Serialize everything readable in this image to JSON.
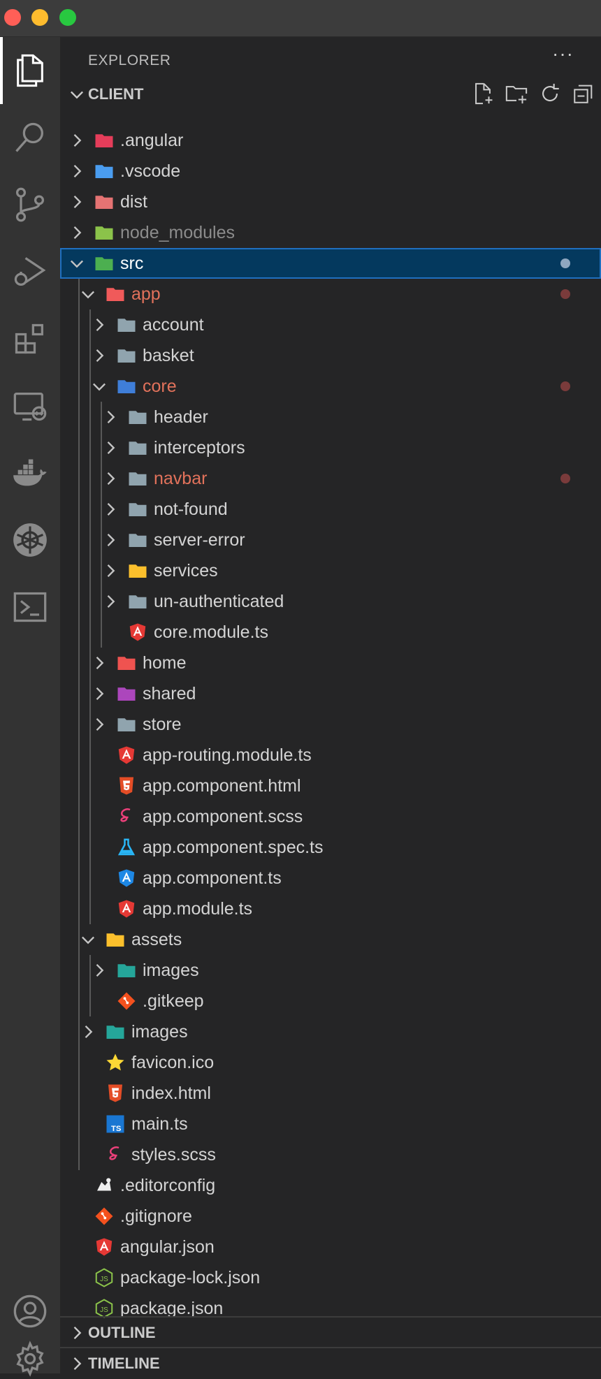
{
  "window": {
    "controls": [
      "close",
      "minimize",
      "maximize"
    ]
  },
  "activity_bar": {
    "items": [
      {
        "name": "explorer-icon",
        "active": true
      },
      {
        "name": "search-icon"
      },
      {
        "name": "source-control-icon"
      },
      {
        "name": "run-debug-icon"
      },
      {
        "name": "extensions-icon"
      },
      {
        "name": "remote-explorer-icon"
      },
      {
        "name": "docker-icon"
      },
      {
        "name": "kubernetes-icon"
      },
      {
        "name": "terminal-icon"
      }
    ],
    "bottom_items": [
      {
        "name": "accounts-icon"
      },
      {
        "name": "settings-gear-icon"
      }
    ]
  },
  "explorer": {
    "title": "EXPLORER",
    "more_label": "···",
    "root_label": "CLIENT",
    "actions": [
      "new-file-icon",
      "new-folder-icon",
      "refresh-icon",
      "collapse-all-icon"
    ],
    "tree": [
      {
        "label": ".angular",
        "type": "folder",
        "depth": 0,
        "expanded": false,
        "icon": "angular-folder-icon",
        "color": "#e53d5a"
      },
      {
        "label": ".vscode",
        "type": "folder",
        "depth": 0,
        "expanded": false,
        "icon": "vscode-folder-icon",
        "color": "#4a9df0"
      },
      {
        "label": "dist",
        "type": "folder",
        "depth": 0,
        "expanded": false,
        "icon": "dist-folder-icon",
        "color": "#e57373"
      },
      {
        "label": "node_modules",
        "type": "folder",
        "depth": 0,
        "expanded": false,
        "icon": "node-folder-icon",
        "color": "#8bc34a",
        "dim": true
      },
      {
        "label": "src",
        "type": "folder",
        "depth": 0,
        "expanded": true,
        "icon": "src-folder-icon",
        "color": "#4caf50",
        "selected": true,
        "dot": true
      },
      {
        "label": "app",
        "type": "folder",
        "depth": 1,
        "expanded": true,
        "icon": "app-folder-icon",
        "color": "#f05a5a",
        "modified": true,
        "dot": true
      },
      {
        "label": "account",
        "type": "folder",
        "depth": 2,
        "expanded": false,
        "icon": "folder-icon",
        "color": "#90a4ae"
      },
      {
        "label": "basket",
        "type": "folder",
        "depth": 2,
        "expanded": false,
        "icon": "folder-icon",
        "color": "#90a4ae"
      },
      {
        "label": "core",
        "type": "folder",
        "depth": 2,
        "expanded": true,
        "icon": "core-folder-icon",
        "color": "#3f7ed8",
        "modified": true,
        "dot": true
      },
      {
        "label": "header",
        "type": "folder",
        "depth": 3,
        "expanded": false,
        "icon": "folder-icon",
        "color": "#90a4ae"
      },
      {
        "label": "interceptors",
        "type": "folder",
        "depth": 3,
        "expanded": false,
        "icon": "folder-icon",
        "color": "#90a4ae"
      },
      {
        "label": "navbar",
        "type": "folder",
        "depth": 3,
        "expanded": false,
        "icon": "folder-icon",
        "color": "#90a4ae",
        "modified": true,
        "dot": true
      },
      {
        "label": "not-found",
        "type": "folder",
        "depth": 3,
        "expanded": false,
        "icon": "folder-icon",
        "color": "#90a4ae"
      },
      {
        "label": "server-error",
        "type": "folder",
        "depth": 3,
        "expanded": false,
        "icon": "folder-icon",
        "color": "#90a4ae"
      },
      {
        "label": "services",
        "type": "folder",
        "depth": 3,
        "expanded": false,
        "icon": "services-folder-icon",
        "color": "#fbc02d"
      },
      {
        "label": "un-authenticated",
        "type": "folder",
        "depth": 3,
        "expanded": false,
        "icon": "folder-icon",
        "color": "#90a4ae"
      },
      {
        "label": "core.module.ts",
        "type": "file",
        "depth": 3,
        "icon": "angular-file-icon",
        "color": "#e53935"
      },
      {
        "label": "home",
        "type": "folder",
        "depth": 2,
        "expanded": false,
        "icon": "home-folder-icon",
        "color": "#ef5350"
      },
      {
        "label": "shared",
        "type": "folder",
        "depth": 2,
        "expanded": false,
        "icon": "shared-folder-icon",
        "color": "#ab47bc"
      },
      {
        "label": "store",
        "type": "folder",
        "depth": 2,
        "expanded": false,
        "icon": "folder-icon",
        "color": "#90a4ae"
      },
      {
        "label": "app-routing.module.ts",
        "type": "file",
        "depth": 2,
        "icon": "angular-file-icon",
        "color": "#e53935"
      },
      {
        "label": "app.component.html",
        "type": "file",
        "depth": 2,
        "icon": "html-file-icon",
        "color": "#e44d26"
      },
      {
        "label": "app.component.scss",
        "type": "file",
        "depth": 2,
        "icon": "scss-file-icon",
        "color": "#ec407a"
      },
      {
        "label": "app.component.spec.ts",
        "type": "file",
        "depth": 2,
        "icon": "test-file-icon",
        "color": "#29b6f6"
      },
      {
        "label": "app.component.ts",
        "type": "file",
        "depth": 2,
        "icon": "angular-component-icon",
        "color": "#1e88e5"
      },
      {
        "label": "app.module.ts",
        "type": "file",
        "depth": 2,
        "icon": "angular-file-icon",
        "color": "#e53935"
      },
      {
        "label": "assets",
        "type": "folder",
        "depth": 1,
        "expanded": true,
        "icon": "assets-folder-icon",
        "color": "#fbc02d"
      },
      {
        "label": "images",
        "type": "folder",
        "depth": 2,
        "expanded": false,
        "icon": "images-folder-icon",
        "color": "#26a69a"
      },
      {
        "label": ".gitkeep",
        "type": "file",
        "depth": 2,
        "icon": "git-file-icon",
        "color": "#f4511e"
      },
      {
        "label": "images",
        "type": "folder",
        "depth": 1,
        "expanded": false,
        "icon": "images-folder-icon",
        "color": "#26a69a"
      },
      {
        "label": "favicon.ico",
        "type": "file",
        "depth": 1,
        "icon": "favicon-star-icon",
        "color": "#fdd835"
      },
      {
        "label": "index.html",
        "type": "file",
        "depth": 1,
        "icon": "html-file-icon",
        "color": "#e44d26"
      },
      {
        "label": "main.ts",
        "type": "file",
        "depth": 1,
        "icon": "typescript-file-icon",
        "color": "#1976d2"
      },
      {
        "label": "styles.scss",
        "type": "file",
        "depth": 1,
        "icon": "scss-file-icon",
        "color": "#ec407a"
      },
      {
        "label": ".editorconfig",
        "type": "file",
        "depth": 0,
        "icon": "editorconfig-file-icon",
        "color": "#eeeeee"
      },
      {
        "label": ".gitignore",
        "type": "file",
        "depth": 0,
        "icon": "git-file-icon",
        "color": "#f4511e"
      },
      {
        "label": "angular.json",
        "type": "file",
        "depth": 0,
        "icon": "angular-file-icon",
        "color": "#e53935"
      },
      {
        "label": "package-lock.json",
        "type": "file",
        "depth": 0,
        "icon": "nodejs-file-icon",
        "color": "#8bc34a"
      },
      {
        "label": "package.json",
        "type": "file",
        "depth": 0,
        "icon": "nodejs-file-icon",
        "color": "#8bc34a"
      }
    ]
  },
  "sections": {
    "outline": "OUTLINE",
    "timeline": "TIMELINE"
  }
}
